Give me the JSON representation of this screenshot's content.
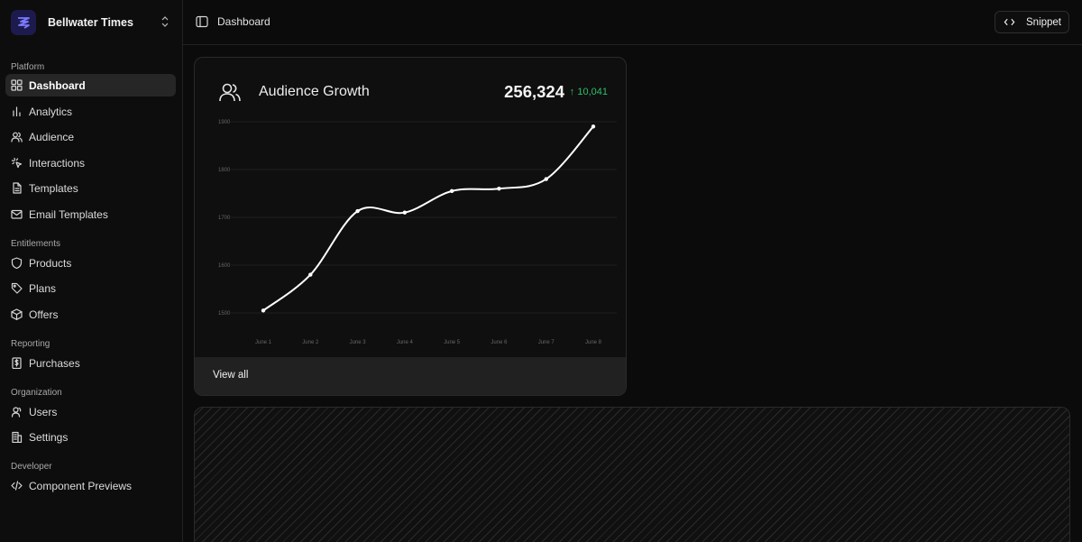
{
  "workspace": {
    "name": "Bellwater Times"
  },
  "sidebar": {
    "groups": [
      {
        "label": "Platform",
        "items": [
          {
            "label": "Dashboard",
            "icon": "grid-icon",
            "active": true
          },
          {
            "label": "Analytics",
            "icon": "bar-chart-icon"
          },
          {
            "label": "Audience",
            "icon": "users-icon"
          },
          {
            "label": "Interactions",
            "icon": "pointer-click-icon"
          },
          {
            "label": "Templates",
            "icon": "file-text-icon"
          },
          {
            "label": "Email Templates",
            "icon": "mail-icon"
          }
        ]
      },
      {
        "label": "Entitlements",
        "items": [
          {
            "label": "Products",
            "icon": "shield-icon"
          },
          {
            "label": "Plans",
            "icon": "tag-icon"
          },
          {
            "label": "Offers",
            "icon": "box-icon"
          }
        ]
      },
      {
        "label": "Reporting",
        "items": [
          {
            "label": "Purchases",
            "icon": "receipt-icon"
          }
        ]
      },
      {
        "label": "Organization",
        "items": [
          {
            "label": "Users",
            "icon": "user-icon"
          },
          {
            "label": "Settings",
            "icon": "building-icon"
          }
        ]
      },
      {
        "label": "Developer",
        "items": [
          {
            "label": "Component Previews",
            "icon": "code-icon"
          }
        ]
      }
    ]
  },
  "topbar": {
    "breadcrumb": "Dashboard",
    "snippet_label": "Snippet"
  },
  "card": {
    "title": "Audience Growth",
    "total": "256,324",
    "delta": "↑ 10,041",
    "footer_label": "View all"
  },
  "colors": {
    "positive": "#2fbf6a",
    "line": "#ffffff",
    "active_bg": "#262626"
  },
  "chart_data": {
    "type": "line",
    "x": [
      "June 1",
      "June 2",
      "June 3",
      "June 4",
      "June 5",
      "June 6",
      "June 7",
      "June 8"
    ],
    "series": [
      {
        "values": [
          1505,
          1580,
          1713,
          1710,
          1755,
          1760,
          1780,
          1890
        ]
      }
    ],
    "yticks": [
      1500,
      1600,
      1700,
      1800,
      1900
    ],
    "ylim": [
      1500,
      1900
    ],
    "grid": true,
    "title": "",
    "xlabel": "",
    "ylabel": ""
  }
}
